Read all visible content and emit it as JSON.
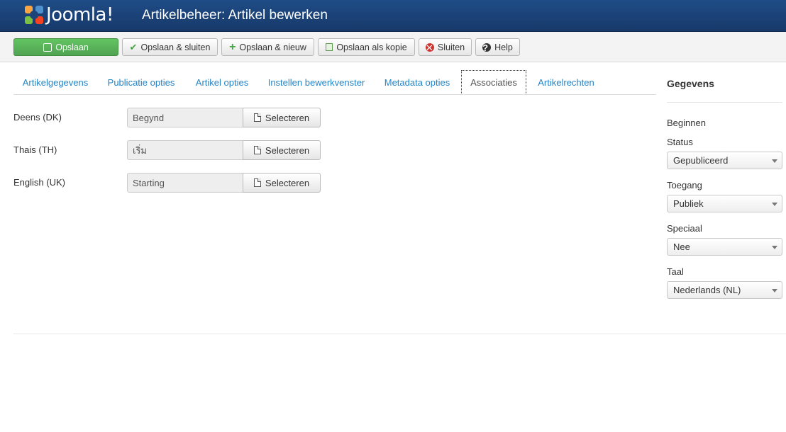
{
  "header": {
    "logo_text": "Joomla!",
    "title": "Artikelbeheer: Artikel bewerken"
  },
  "toolbar": {
    "save": "Opslaan",
    "save_close": "Opslaan & sluiten",
    "save_new": "Opslaan & nieuw",
    "save_copy": "Opslaan als kopie",
    "close": "Sluiten",
    "help": "Help"
  },
  "tabs": [
    "Artikelgegevens",
    "Publicatie opties",
    "Artikel opties",
    "Instellen bewerkvenster",
    "Metadata opties",
    "Associaties",
    "Artikelrechten"
  ],
  "active_tab": "Associaties",
  "associations": [
    {
      "language": "Deens (DK)",
      "value": "Begynd",
      "button": "Selecteren"
    },
    {
      "language": "Thais (TH)",
      "value": "เริ่ม",
      "button": "Selecteren"
    },
    {
      "language": "English (UK)",
      "value": "Starting",
      "button": "Selecteren"
    }
  ],
  "sidebar": {
    "title": "Gegevens",
    "article_title": "Beginnen",
    "status_label": "Status",
    "status_value": "Gepubliceerd",
    "access_label": "Toegang",
    "access_value": "Publiek",
    "featured_label": "Speciaal",
    "featured_value": "Nee",
    "language_label": "Taal",
    "language_value": "Nederlands (NL)"
  },
  "colors": {
    "header_bg": "#1f4c86",
    "success": "#51a351",
    "link": "#2384c6"
  },
  "icons": {
    "save": "save-icon",
    "save_close": "check-icon",
    "save_new": "plus-icon",
    "save_copy": "copy-icon",
    "close": "close-circle-icon",
    "help": "question-circle-icon",
    "select": "file-icon",
    "dropdown": "chevron-down-icon"
  }
}
